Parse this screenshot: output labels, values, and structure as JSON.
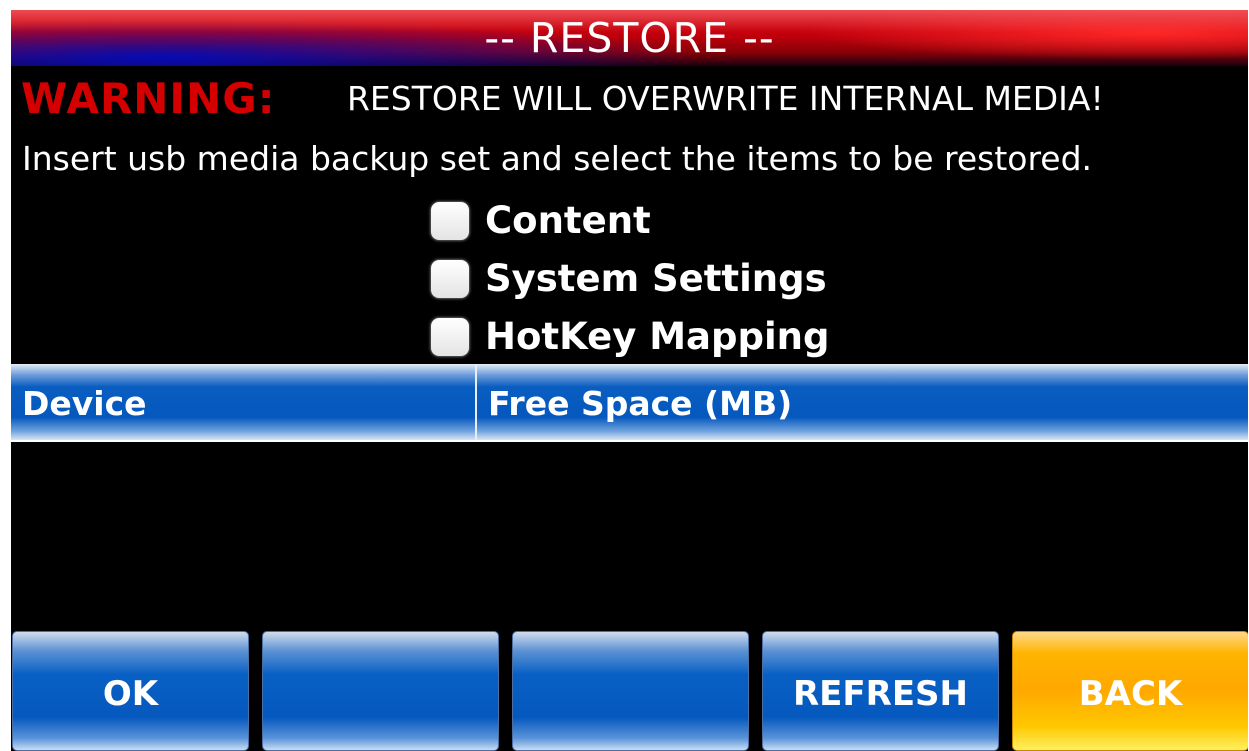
{
  "title": "-- RESTORE --",
  "warning": {
    "label": "WARNING:",
    "message": "RESTORE WILL OVERWRITE INTERNAL MEDIA!"
  },
  "instruction": "Insert usb media backup set and select the items to be restored.",
  "options": [
    {
      "label": "Content",
      "checked": false
    },
    {
      "label": "System Settings",
      "checked": false
    },
    {
      "label": "HotKey Mapping",
      "checked": false
    }
  ],
  "table": {
    "columns": [
      "Device",
      "Free Space (MB)"
    ],
    "rows": []
  },
  "buttons": {
    "ok": "OK",
    "blank1": "",
    "blank2": "",
    "refresh": "REFRESH",
    "back": "BACK"
  },
  "colors": {
    "warning": "#d40000",
    "button_blue": "#0558be",
    "back_orange": "#ffa800",
    "title_red": "#c0000c"
  }
}
